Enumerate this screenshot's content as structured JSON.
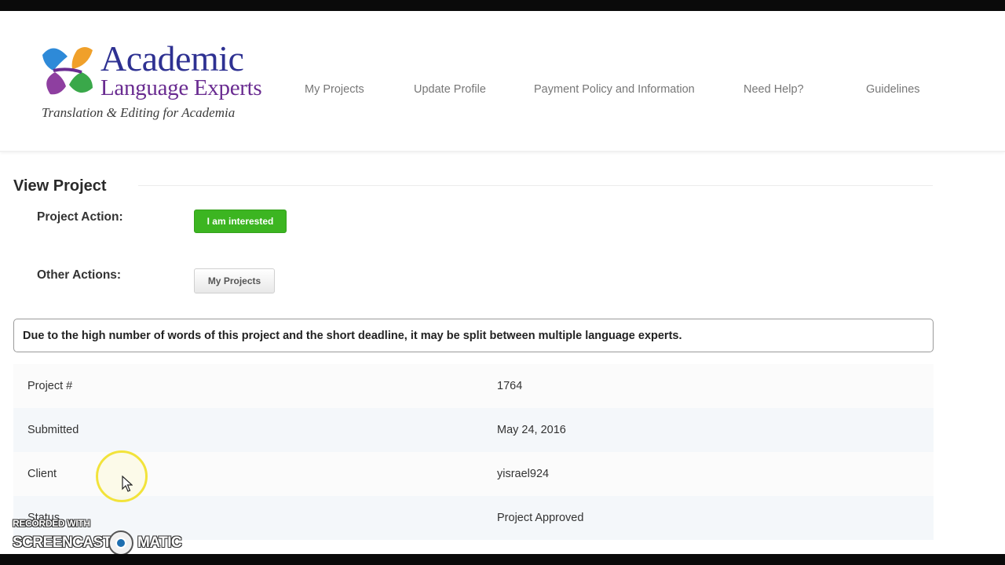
{
  "brand": {
    "name_line1": "Academic",
    "name_line2": "Language Experts",
    "tagline": "Translation & Editing for Academia",
    "colors": {
      "primary": "#2e3192",
      "secondary": "#6a2c91",
      "accent_green": "#3cb521"
    }
  },
  "nav": {
    "items": [
      {
        "label": "My Projects"
      },
      {
        "label": "Update Profile"
      },
      {
        "label": "Payment Policy and Information"
      },
      {
        "label": "Need Help?"
      },
      {
        "label": "Guidelines"
      }
    ]
  },
  "page": {
    "title": "View Project",
    "project_action_label": "Project Action:",
    "interested_button": "I am interested",
    "other_actions_label": "Other Actions:",
    "my_projects_button": "My Projects",
    "notice": "Due to the high number of words of this project and the short deadline, it may be split between multiple language experts."
  },
  "details": {
    "rows": [
      {
        "key": "Project #",
        "value": "1764"
      },
      {
        "key": "Submitted",
        "value": "May 24, 2016"
      },
      {
        "key": "Client",
        "value": "yisrael924"
      },
      {
        "key": "Status",
        "value": "Project Approved"
      }
    ]
  },
  "watermark": {
    "line1": "RECORDED WITH",
    "line2a": "SCREENCAST",
    "line2b": "MATIC"
  }
}
